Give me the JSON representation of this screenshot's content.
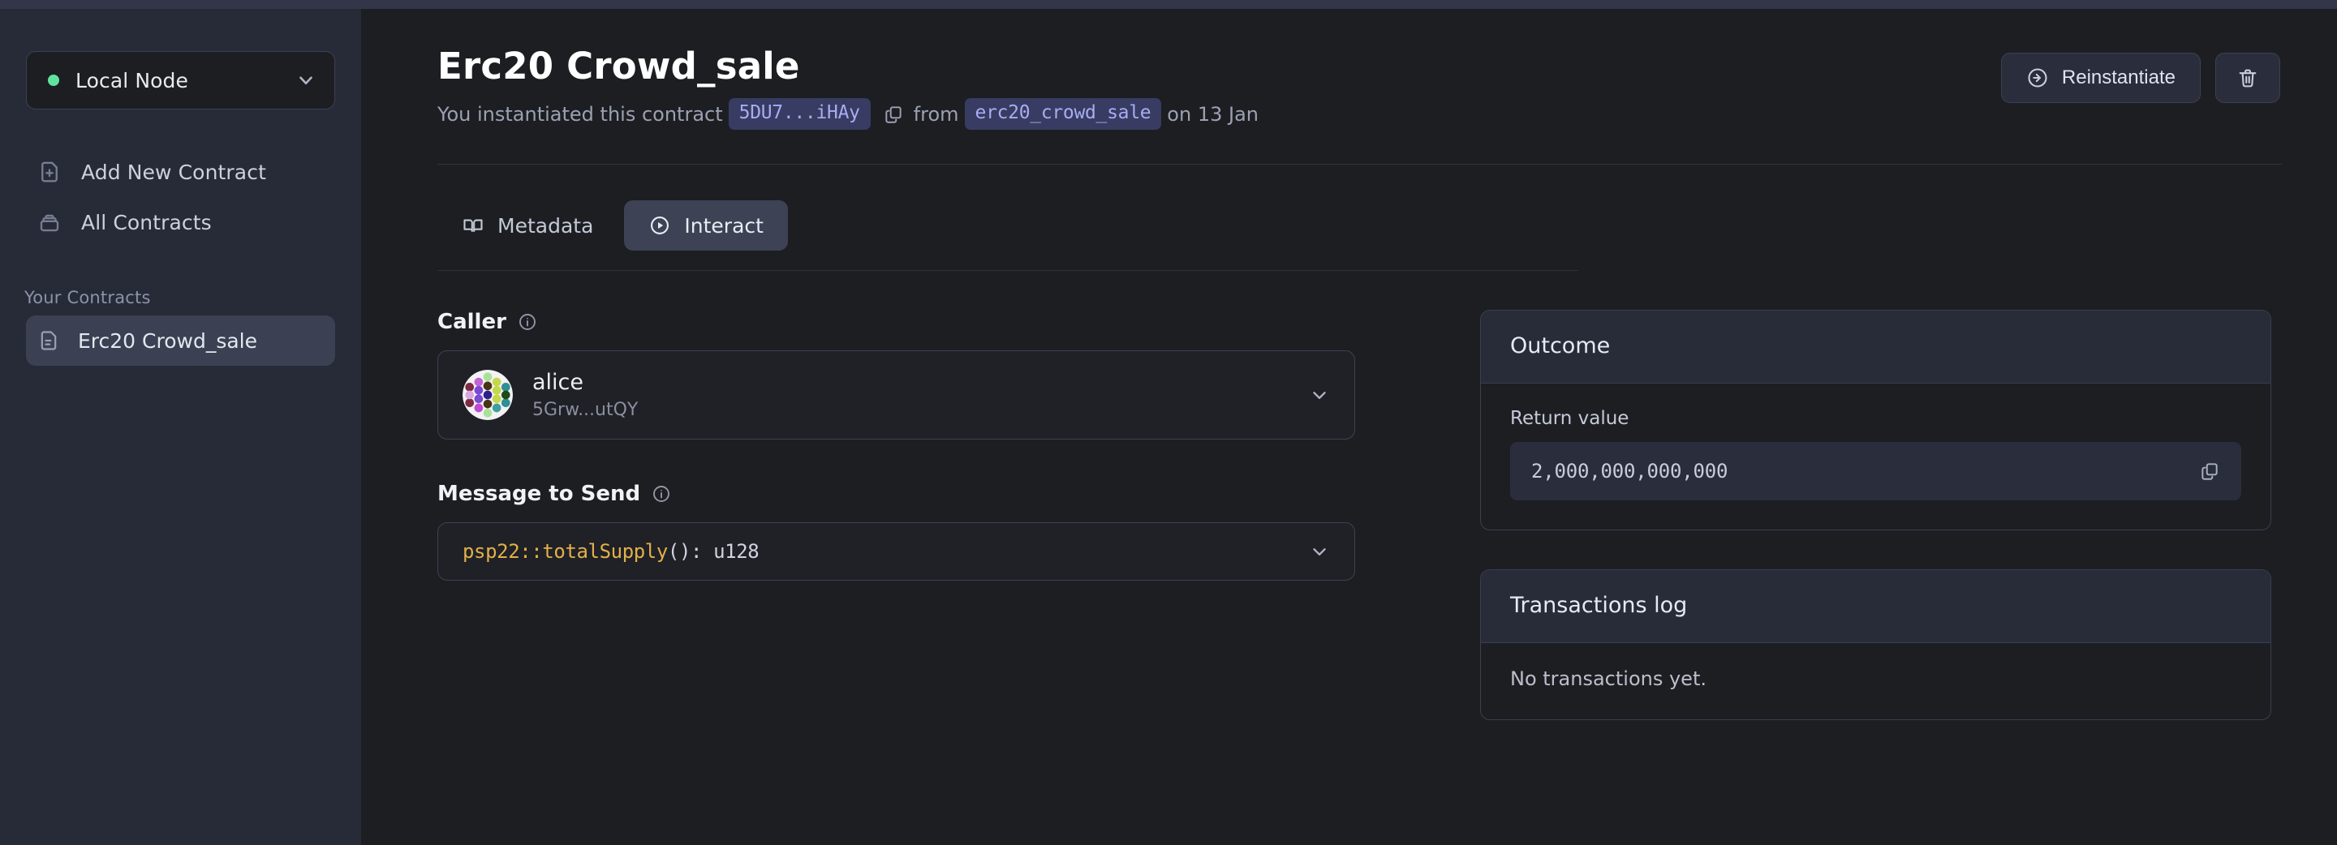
{
  "sidebar": {
    "node_selector": {
      "label": "Local Node",
      "status_color": "#5fe3a1",
      "chevron_icon": "chevron-down-icon"
    },
    "nav": [
      {
        "label": "Add New Contract",
        "icon": "file-plus-icon"
      },
      {
        "label": "All Contracts",
        "icon": "archive-icon"
      }
    ],
    "section_label": "Your Contracts",
    "contracts": [
      {
        "label": "Erc20 Crowd_sale",
        "icon": "file-text-icon",
        "selected": true
      }
    ]
  },
  "header": {
    "title": "Erc20 Crowd_sale",
    "subtitle_prefix": "You instantiated this contract",
    "address_badge": "5DU7...iHAy",
    "copy_icon": "copy-icon",
    "from_word": "from",
    "code_badge": "erc20_crowd_sale",
    "date_text": "on 13 Jan",
    "actions": {
      "reinstantiate_label": "Reinstantiate",
      "reinstantiate_icon": "arrow-right-circle-icon",
      "delete_icon": "trash-icon"
    }
  },
  "tabs": [
    {
      "label": "Metadata",
      "icon": "book-open-icon",
      "active": false
    },
    {
      "label": "Interact",
      "icon": "play-circle-icon",
      "active": true
    }
  ],
  "form": {
    "caller": {
      "label": "Caller",
      "info_icon": "info-icon",
      "account_name": "alice",
      "account_address": "5Grw...utQY",
      "avatar_icon": "identicon-avatar",
      "chevron_icon": "chevron-down-icon"
    },
    "message": {
      "label": "Message to Send",
      "info_icon": "info-icon",
      "value_fn": "psp22::totalSupply",
      "value_parens": "():",
      "value_type": "u128",
      "chevron_icon": "chevron-down-icon"
    }
  },
  "outcome": {
    "title": "Outcome",
    "return_value_label": "Return value",
    "return_value": "2,000,000,000,000",
    "copy_icon": "copy-icon"
  },
  "transactions": {
    "title": "Transactions log",
    "empty_text": "No transactions yet."
  },
  "colors": {
    "accent_green": "#5fe3a1",
    "badge_bg": "#383c63",
    "badge_text": "#a7adf0",
    "code_orange": "#e2b04a",
    "sidebar_bg": "#272b38",
    "main_bg": "#1d1e22"
  }
}
